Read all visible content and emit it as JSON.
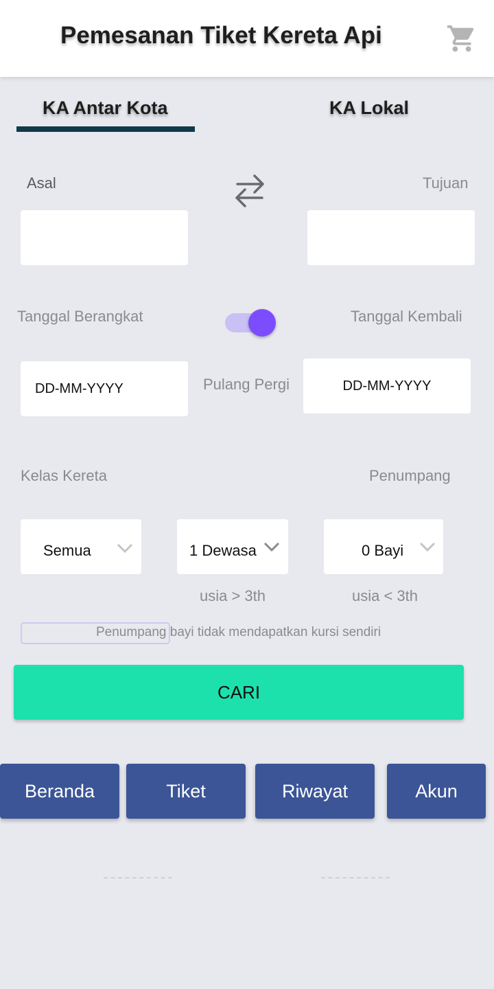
{
  "header": {
    "title": "Pemesanan Tiket Kereta Api",
    "cart_icon": "cart-icon"
  },
  "tabs": [
    {
      "label": "KA Antar Kota",
      "active": true
    },
    {
      "label": "KA Lokal",
      "active": false
    }
  ],
  "route": {
    "origin_label": "Asal",
    "origin_value": "",
    "destination_label": "Tujuan",
    "destination_value": "",
    "swap_icon": "swap-arrows-icon"
  },
  "dates": {
    "depart_label": "Tanggal Berangkat",
    "depart_value": "DD-MM-YYYY",
    "return_label": "Tanggal Kembali",
    "return_value": "DD-MM-YYYY",
    "round_trip_label": "Pulang Pergi",
    "round_trip_enabled": true
  },
  "class": {
    "label": "Kelas Kereta",
    "selected": "Semua"
  },
  "passengers": {
    "label": "Penumpang",
    "adult_selected": "1 Dewasa",
    "adult_hint": "usia > 3th",
    "infant_selected": "0 Bayi",
    "infant_hint": "usia < 3th"
  },
  "infant_note": "Penumpang bayi tidak mendapatkan kursi sendiri",
  "search_button": "CARI",
  "bottom_nav": [
    "Beranda",
    "Tiket",
    "Riwayat",
    "Akun"
  ],
  "colors": {
    "accent_button": "#1de1ad",
    "nav_button": "#3b5596",
    "tab_indicator": "#103a48",
    "toggle_thumb": "#7c4dff",
    "background": "#e8e9ef"
  }
}
